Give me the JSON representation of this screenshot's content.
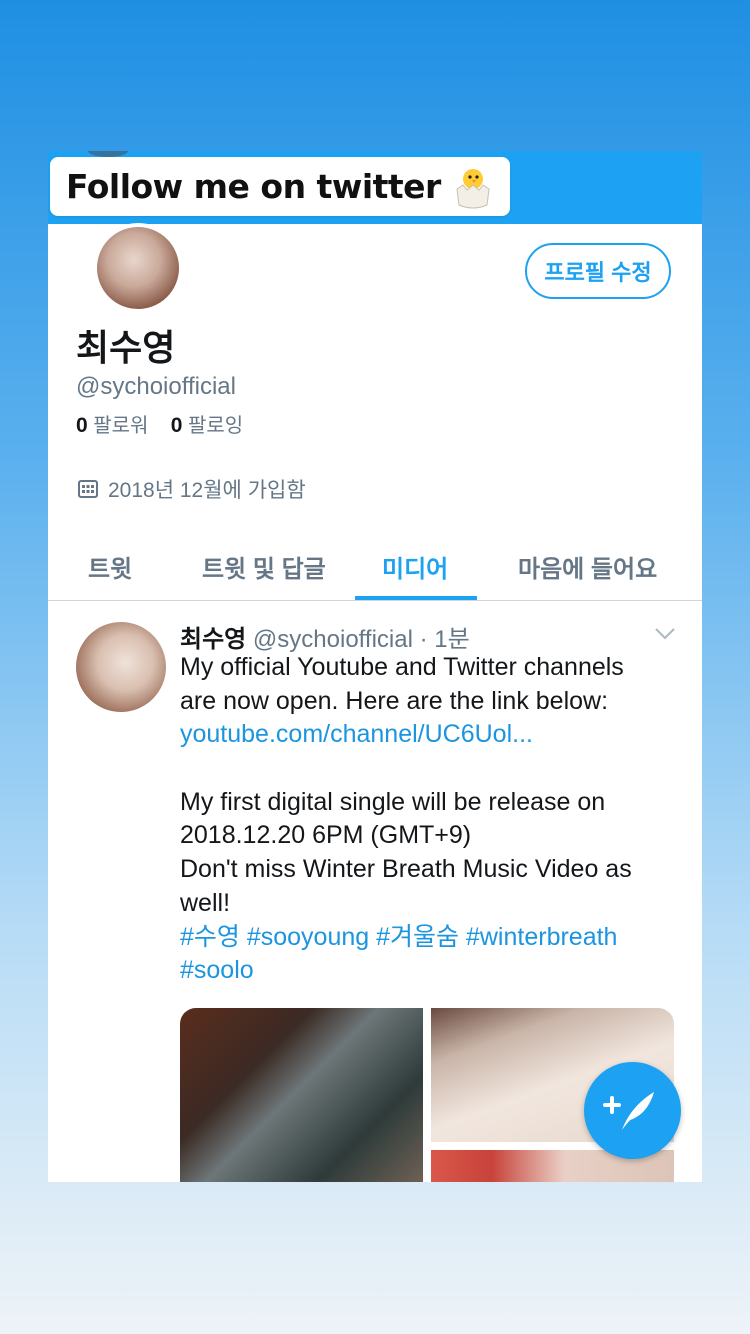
{
  "banner": {
    "sticker_text": "Follow me on twitter",
    "sticker_icon": "hatching-chick-icon"
  },
  "profile": {
    "edit_button": "프로필 수정",
    "name": "최수영",
    "handle": "@sychoiofficial",
    "followers_count": "0",
    "followers_label": "팔로워",
    "following_count": "0",
    "following_label": "팔로잉",
    "joined": "2018년 12월에 가입함"
  },
  "tabs": [
    {
      "label": "트윗",
      "active": false
    },
    {
      "label": "트윗 및 답글",
      "active": false
    },
    {
      "label": "미디어",
      "active": true
    },
    {
      "label": "마음에 들어요",
      "active": false
    }
  ],
  "tweet": {
    "name": "최수영",
    "handle": "@sychoiofficial",
    "time": "· 1분",
    "lines": [
      "My official Youtube and Twitter channels",
      "are now open. Here are the link below:"
    ],
    "link": "youtube.com/channel/UC6Uol...",
    "lines2": [
      "My first digital single will be release on",
      "2018.12.20 6PM (GMT+9)",
      "Don't miss Winter Breath Music Video as",
      "well!"
    ],
    "hashtags_line1": " #수영 #sooyoung #겨울숨 #winterbreath",
    "hashtags_line2": "#soolo"
  },
  "colors": {
    "accent": "#1da1f2",
    "link": "#1b95e0",
    "text": "#14171a",
    "secondary": "#657786"
  },
  "fab_icon": "compose-tweet-icon"
}
